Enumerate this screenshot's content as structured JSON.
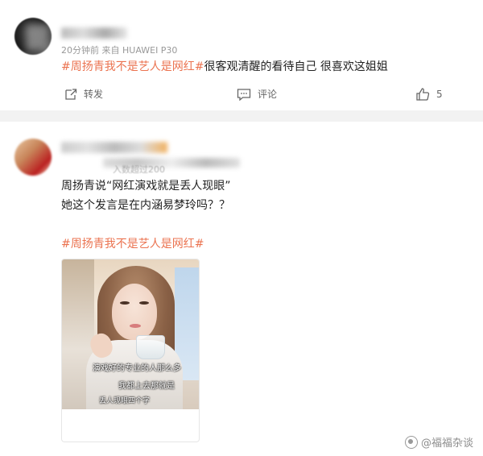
{
  "post1": {
    "meta": "20分钟前  来自 HUAWEI P30",
    "hashtag": "#周扬青我不是艺人是网红#",
    "text": "很客观清醒的看待自己 很喜欢这姐姐",
    "actions": {
      "forward_label": "转发",
      "comment_label": "评论",
      "like_count": "5"
    }
  },
  "post2": {
    "meta": "入数超过200",
    "line1": "周扬青说“网红演戏就是丢人现眼”",
    "line2": "她这个发言是在内涵易梦玲吗？？",
    "hashtag": "#周扬青我不是艺人是网红#",
    "image": {
      "subtitle1": "演戏好的专业的人那么多",
      "subtitle2": "我都上去那就是",
      "subtitle3": "丢人现眼四个字"
    }
  },
  "watermark": {
    "text": "@福福杂谈"
  },
  "colors": {
    "hashtag": "#eb7350",
    "divider": "#f2f2f2",
    "meta": "#999999"
  }
}
